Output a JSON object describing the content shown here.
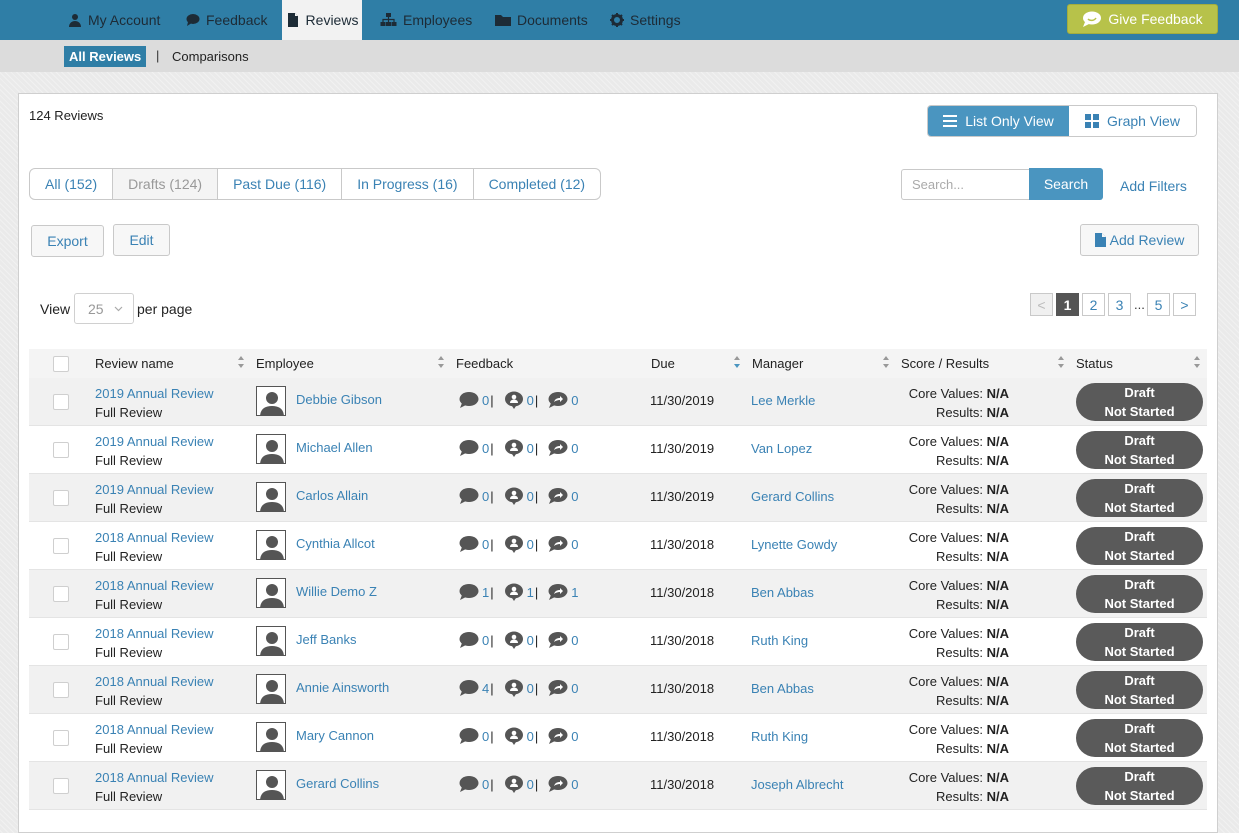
{
  "topnav": {
    "items": [
      {
        "label": "My Account",
        "icon": "user-icon"
      },
      {
        "label": "Feedback",
        "icon": "speech-bubble-icon"
      },
      {
        "label": "Reviews",
        "icon": "document-icon",
        "active": true
      },
      {
        "label": "Employees",
        "icon": "org-chart-icon"
      },
      {
        "label": "Documents",
        "icon": "folder-icon"
      },
      {
        "label": "Settings",
        "icon": "gear-icon"
      }
    ],
    "give_feedback": "Give Feedback"
  },
  "subnav": {
    "active": "All Reviews",
    "separator": "|",
    "other": "Comparisons"
  },
  "summary": {
    "count_label": "124 Reviews"
  },
  "view_toggle": {
    "list": "List Only View",
    "graph": "Graph View"
  },
  "filters": {
    "tabs": [
      {
        "label": "All (152)",
        "disabled": false
      },
      {
        "label": "Drafts (124)",
        "disabled": true
      },
      {
        "label": "Past Due (116)",
        "disabled": false
      },
      {
        "label": "In Progress (16)",
        "disabled": false
      },
      {
        "label": "Completed (12)",
        "disabled": false
      }
    ]
  },
  "search": {
    "placeholder": "Search...",
    "button": "Search",
    "add_filters": "Add Filters"
  },
  "actions": {
    "export": "Export",
    "edit": "Edit",
    "add_review": "Add Review"
  },
  "pagination": {
    "view_label": "View",
    "per_page_value": "25",
    "per_page_label": "per page",
    "prev": "<",
    "pages": [
      "1",
      "2",
      "3"
    ],
    "ellipsis": "...",
    "last": "5",
    "next": ">",
    "current": "1"
  },
  "table": {
    "columns": {
      "review": "Review name",
      "employee": "Employee",
      "feedback": "Feedback",
      "due": "Due",
      "manager": "Manager",
      "score": "Score / Results",
      "status": "Status"
    },
    "score_labels": {
      "core": "Core Values:",
      "results": "Results:"
    },
    "rows": [
      {
        "review": "2019 Annual Review",
        "type": "Full Review",
        "employee": "Debbie Gibson",
        "fb": [
          "0",
          "0",
          "0"
        ],
        "due": "11/30/2019",
        "manager": "Lee Merkle",
        "core": "N/A",
        "results": "N/A",
        "status1": "Draft",
        "status2": "Not Started"
      },
      {
        "review": "2019 Annual Review",
        "type": "Full Review",
        "employee": "Michael Allen",
        "fb": [
          "0",
          "0",
          "0"
        ],
        "due": "11/30/2019",
        "manager": "Van Lopez",
        "core": "N/A",
        "results": "N/A",
        "status1": "Draft",
        "status2": "Not Started"
      },
      {
        "review": "2019 Annual Review",
        "type": "Full Review",
        "employee": "Carlos Allain",
        "fb": [
          "0",
          "0",
          "0"
        ],
        "due": "11/30/2019",
        "manager": "Gerard Collins",
        "core": "N/A",
        "results": "N/A",
        "status1": "Draft",
        "status2": "Not Started"
      },
      {
        "review": "2018 Annual Review",
        "type": "Full Review",
        "employee": "Cynthia Allcot",
        "fb": [
          "0",
          "0",
          "0"
        ],
        "due": "11/30/2018",
        "manager": "Lynette Gowdy",
        "core": "N/A",
        "results": "N/A",
        "status1": "Draft",
        "status2": "Not Started"
      },
      {
        "review": "2018 Annual Review",
        "type": "Full Review",
        "employee": "Willie Demo Z",
        "fb": [
          "1",
          "1",
          "1"
        ],
        "due": "11/30/2018",
        "manager": "Ben Abbas",
        "core": "N/A",
        "results": "N/A",
        "status1": "Draft",
        "status2": "Not Started"
      },
      {
        "review": "2018 Annual Review",
        "type": "Full Review",
        "employee": "Jeff Banks",
        "fb": [
          "0",
          "0",
          "0"
        ],
        "due": "11/30/2018",
        "manager": "Ruth King",
        "core": "N/A",
        "results": "N/A",
        "status1": "Draft",
        "status2": "Not Started"
      },
      {
        "review": "2018 Annual Review",
        "type": "Full Review",
        "employee": "Annie Ainsworth",
        "fb": [
          "4",
          "0",
          "0"
        ],
        "due": "11/30/2018",
        "manager": "Ben Abbas",
        "core": "N/A",
        "results": "N/A",
        "status1": "Draft",
        "status2": "Not Started"
      },
      {
        "review": "2018 Annual Review",
        "type": "Full Review",
        "employee": "Mary Cannon",
        "fb": [
          "0",
          "0",
          "0"
        ],
        "due": "11/30/2018",
        "manager": "Ruth King",
        "core": "N/A",
        "results": "N/A",
        "status1": "Draft",
        "status2": "Not Started"
      },
      {
        "review": "2018 Annual Review",
        "type": "Full Review",
        "employee": "Gerard Collins",
        "fb": [
          "0",
          "0",
          "0"
        ],
        "due": "11/30/2018",
        "manager": "Joseph Albrecht",
        "core": "N/A",
        "results": "N/A",
        "status1": "Draft",
        "status2": "Not Started"
      }
    ]
  },
  "colors": {
    "nav": "#2f7ea6",
    "accent": "#4a95c0",
    "link": "#3a82b4",
    "give_feedback": "#b7c24a",
    "status_pill": "#5a5a5a"
  }
}
